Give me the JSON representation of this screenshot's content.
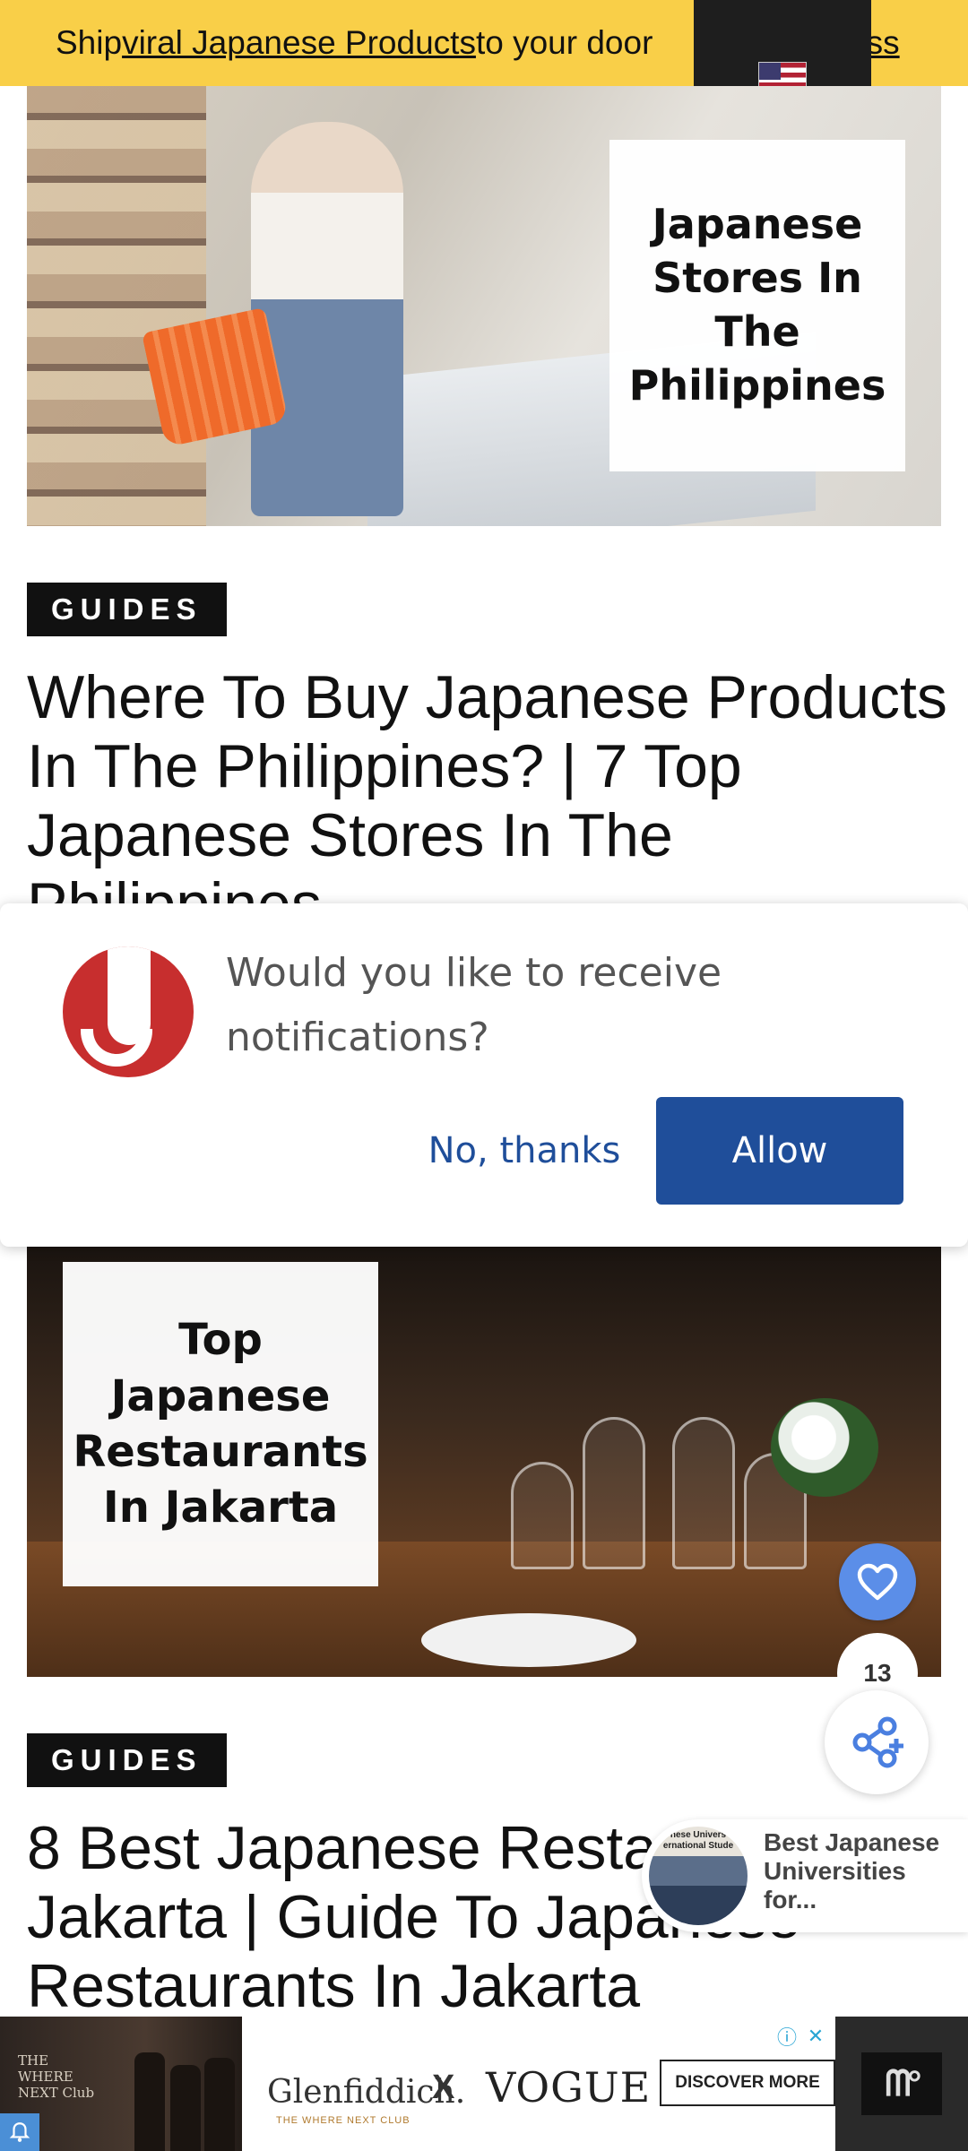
{
  "promo": {
    "text_before": "Ship ",
    "link_text": "viral Japanese Products ",
    "text_after": "to your door",
    "link_tail": "iss"
  },
  "language_popup": {
    "flag_icon": "us-flag-icon"
  },
  "articles": [
    {
      "image_label": "Japanese Stores In The Philippines",
      "tag": "GUIDES",
      "title": "Where To Buy Japanese Products In The Philippines? | 7 Top Japanese Stores In The Philippines"
    },
    {
      "image_label": "Top Japanese Restaurants In Jakarta",
      "tag": "GUIDES",
      "title": "8 Best Japanese Restaurants In Jakarta | Guide To Japanese Restaurants In Jakarta"
    }
  ],
  "notification": {
    "message": "Would you like to receive notifications?",
    "decline_label": "No, thanks",
    "allow_label": "Allow",
    "accent_color": "#1f4e9a"
  },
  "social": {
    "like_count": "13",
    "like_icon": "heart-icon",
    "share_icon": "share-icon"
  },
  "related": {
    "thumb_text": "nese Univers ernational Stude",
    "title": "Best Japanese Universities for..."
  },
  "ad": {
    "left_text": "THE WHERE NEXT Club",
    "brand": "Glenfiddich.",
    "brand_sub": "THE WHERE NEXT CLUB",
    "x": "X",
    "partner": "VOGUE",
    "cta": "DISCOVER MORE",
    "right_logo": "ᗰ°"
  },
  "colors": {
    "promo_bg": "#f9cf48",
    "tag_bg": "#111111",
    "fab_like_bg": "#5b8ee8"
  }
}
